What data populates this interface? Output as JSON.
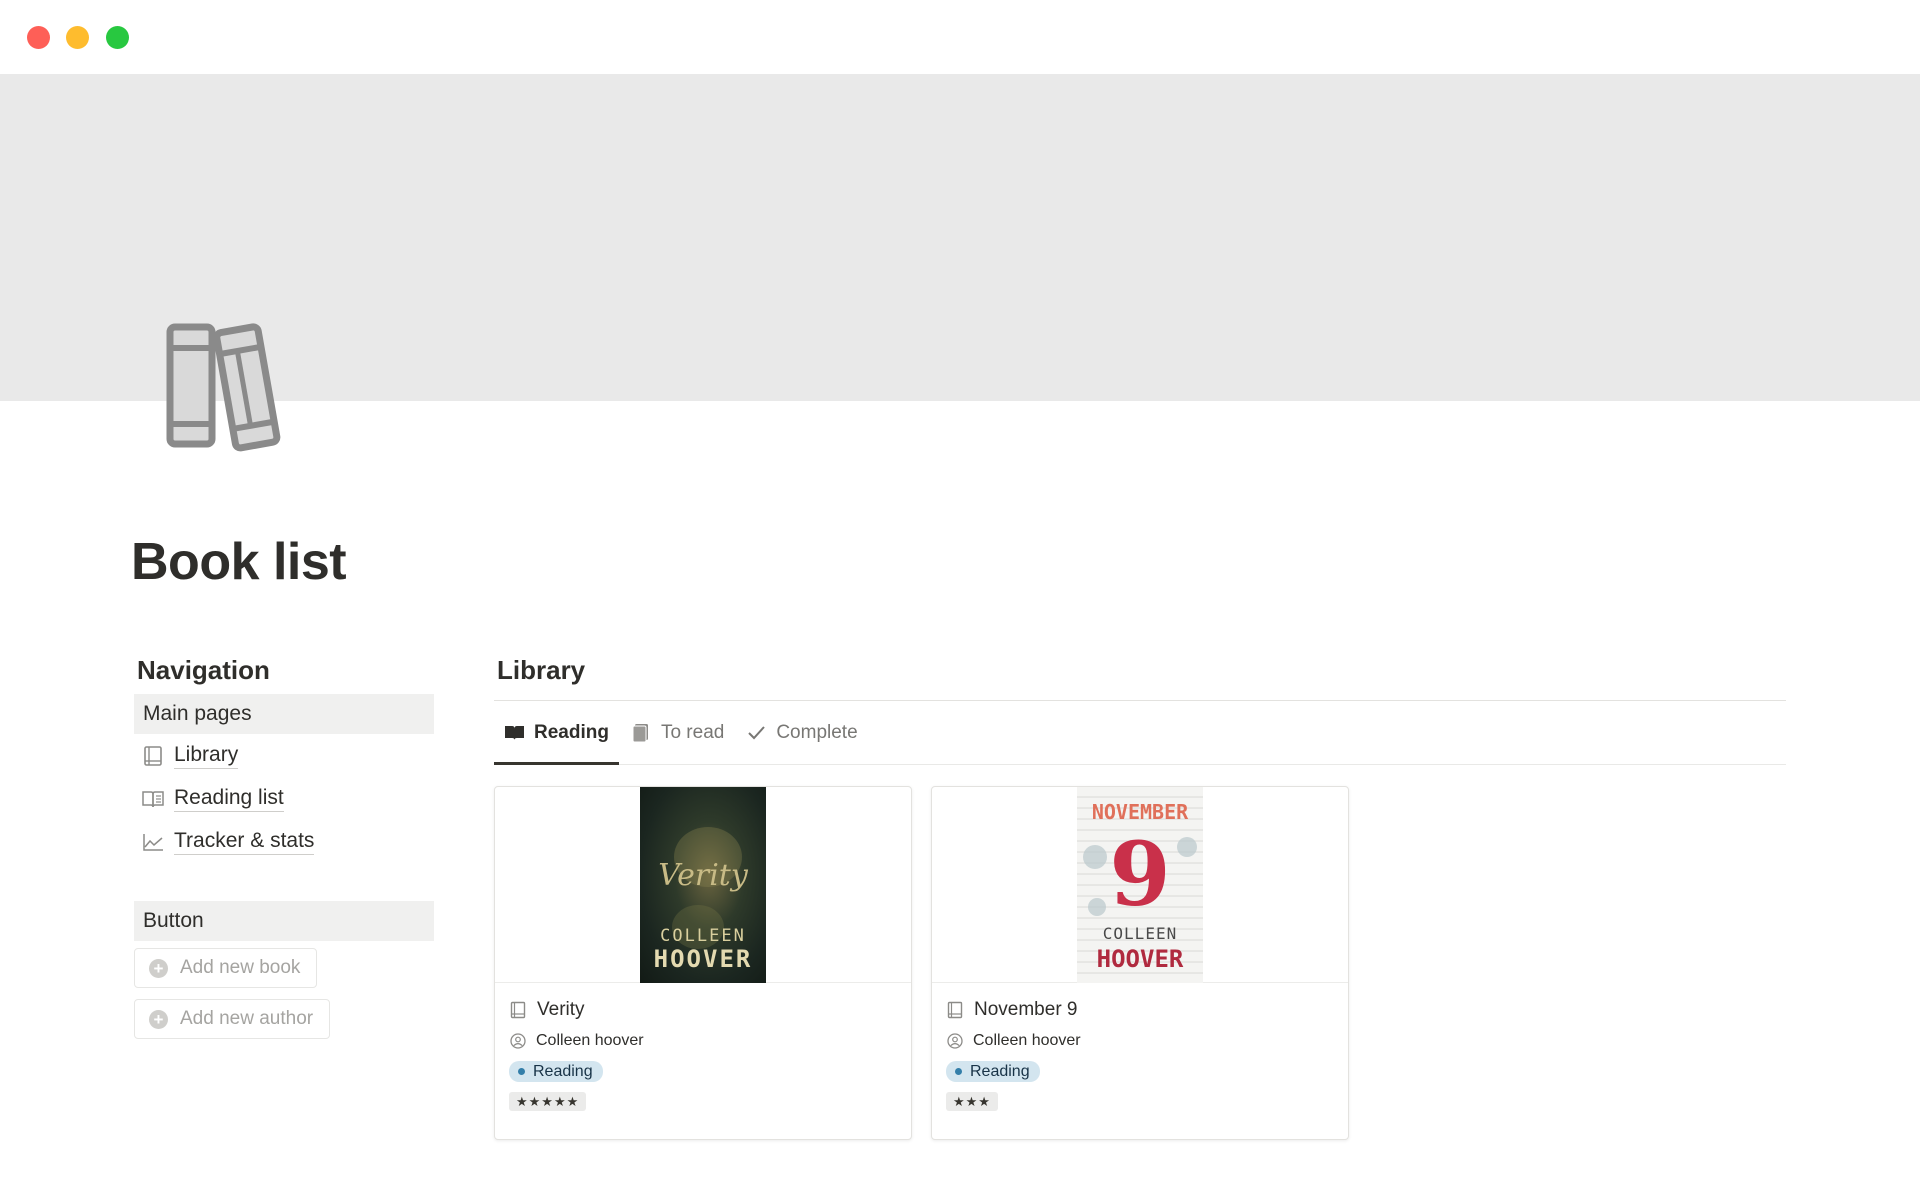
{
  "page": {
    "title": "Book list"
  },
  "navigation": {
    "heading": "Navigation",
    "section": "Main pages",
    "items": [
      {
        "label": "Library",
        "icon": "book-icon"
      },
      {
        "label": "Reading list",
        "icon": "open-book-icon"
      },
      {
        "label": "Tracker & stats",
        "icon": "chart-line-icon"
      }
    ]
  },
  "buttons": {
    "heading": "Button",
    "add_book": "Add new book",
    "add_author": "Add new author"
  },
  "library": {
    "heading": "Library",
    "tabs": [
      {
        "label": "Reading",
        "icon": "open-book-icon",
        "active": true
      },
      {
        "label": "To read",
        "icon": "books-icon",
        "active": false
      },
      {
        "label": "Complete",
        "icon": "checkmark-icon",
        "active": false
      }
    ],
    "cards": [
      {
        "title": "Verity",
        "author": "Colleen hoover",
        "status": "Reading",
        "rating": "★★★★★",
        "cover": {
          "line1": "Verity",
          "line2": "COLLEEN",
          "line3": "HOOVER"
        }
      },
      {
        "title": "November 9",
        "author": "Colleen hoover",
        "status": "Reading",
        "rating": "★★★",
        "cover": {
          "line1": "NOVEMBER",
          "line2": "9",
          "line3": "COLLEEN",
          "line4": "HOOVER"
        }
      }
    ]
  },
  "colors": {
    "cover_bg": "#e9e9e9",
    "status_pill_bg": "#d3e5ef",
    "status_dot": "#337ea9",
    "text_primary": "#2f2e2b",
    "text_muted": "#787774"
  }
}
